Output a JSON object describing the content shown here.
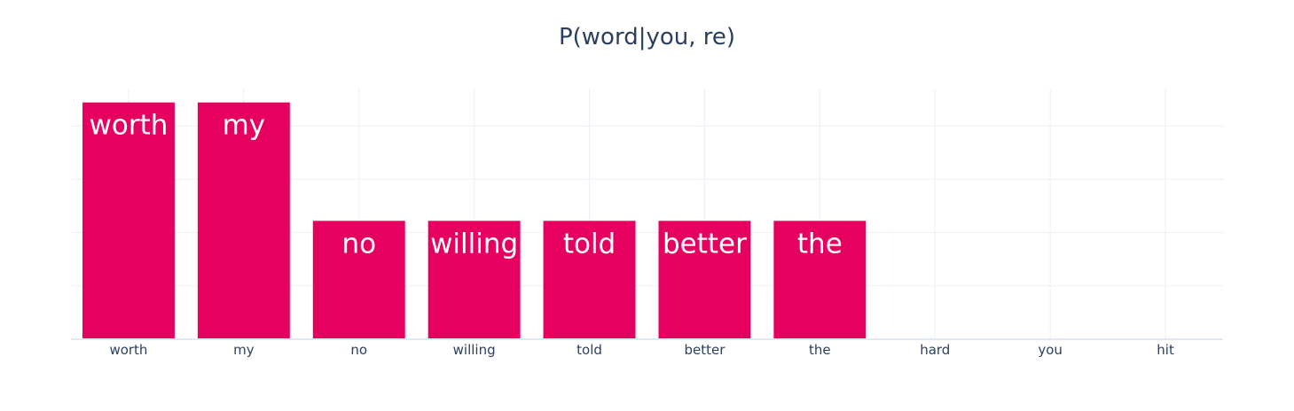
{
  "chart_data": {
    "type": "bar",
    "title": "P(word|you, re)",
    "xlabel": "",
    "ylabel": "",
    "categories": [
      "worth",
      "my",
      "no",
      "willing",
      "told",
      "better",
      "the",
      "hard",
      "you",
      "hit"
    ],
    "values": [
      0.222,
      0.222,
      0.111,
      0.111,
      0.111,
      0.111,
      0.111,
      0,
      0,
      0
    ],
    "bar_labels": [
      "worth",
      "my",
      "no",
      "willing",
      "told",
      "better",
      "the",
      "",
      "",
      ""
    ],
    "ylim": [
      0,
      0.235
    ],
    "y_gridlines": [
      0.05,
      0.1,
      0.15,
      0.2
    ],
    "grid": true,
    "y_tick_labels_visible": false,
    "bar_color": "#e60060",
    "title_color": "#2a3f5f",
    "tick_color": "#2a3f5f",
    "grid_color": "#ebeff5"
  }
}
